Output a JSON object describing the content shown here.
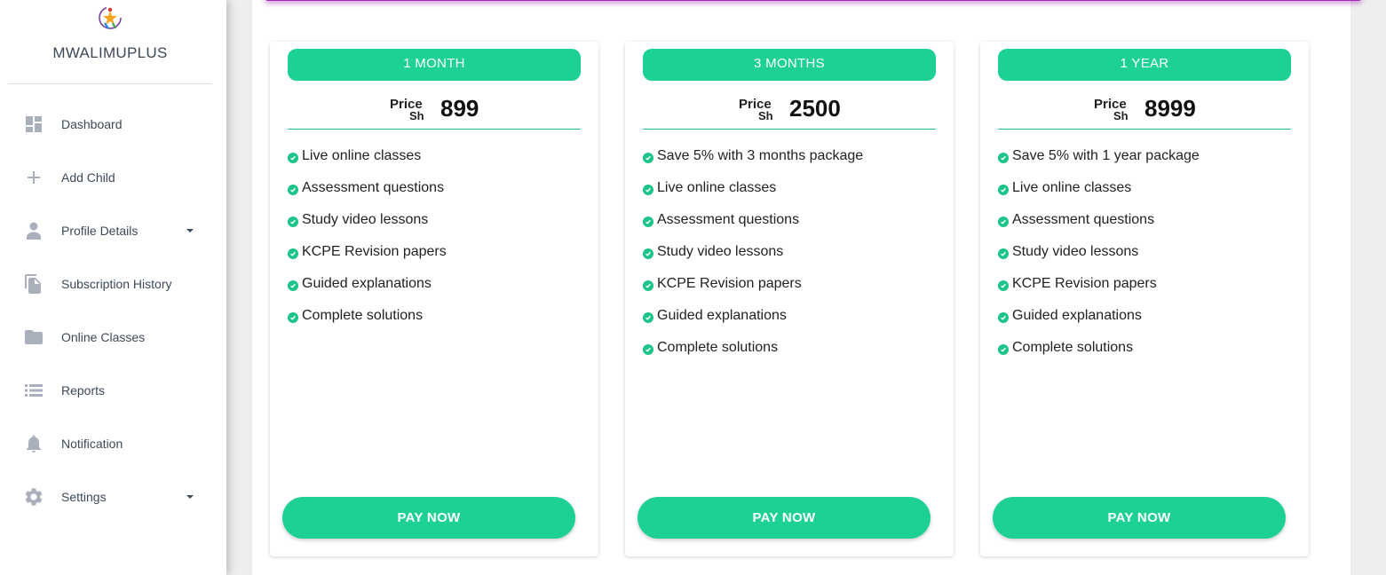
{
  "brand": {
    "name": "MWALIMUPLUS"
  },
  "sidebar": {
    "items": [
      {
        "label": "Dashboard",
        "icon": "dashboard-icon"
      },
      {
        "label": "Add Child",
        "icon": "plus-icon"
      },
      {
        "label": "Profile Details",
        "icon": "person-icon",
        "has_dropdown": true
      },
      {
        "label": "Subscription History",
        "icon": "file-copy-icon"
      },
      {
        "label": "Online Classes",
        "icon": "folder-icon"
      },
      {
        "label": "Reports",
        "icon": "list-icon"
      },
      {
        "label": "Notification",
        "icon": "bell-icon"
      },
      {
        "label": "Settings",
        "icon": "gear-icon",
        "has_dropdown": true
      }
    ]
  },
  "colors": {
    "accent": "#1cd191",
    "header_strip": "#9c27b0",
    "check": "#1cc488"
  },
  "plans": [
    {
      "title": "1 MONTH",
      "price_label": "Price",
      "currency": "Sh",
      "price": "899",
      "features": [
        "Live online classes",
        "Assessment questions",
        "Study video lessons",
        "KCPE Revision papers",
        "Guided explanations",
        "Complete solutions"
      ],
      "button": "PAY NOW"
    },
    {
      "title": "3 MONTHS",
      "price_label": "Price",
      "currency": "Sh",
      "price": "2500",
      "features": [
        "Save 5% with 3 months package",
        "Live online classes",
        "Assessment questions",
        "Study video lessons",
        "KCPE Revision papers",
        "Guided explanations",
        "Complete solutions"
      ],
      "button": "PAY NOW"
    },
    {
      "title": "1 YEAR",
      "price_label": "Price",
      "currency": "Sh",
      "price": "8999",
      "features": [
        "Save 5% with 1 year package",
        "Live online classes",
        "Assessment questions",
        "Study video lessons",
        "KCPE Revision papers",
        "Guided explanations",
        "Complete solutions"
      ],
      "button": "PAY NOW"
    }
  ]
}
